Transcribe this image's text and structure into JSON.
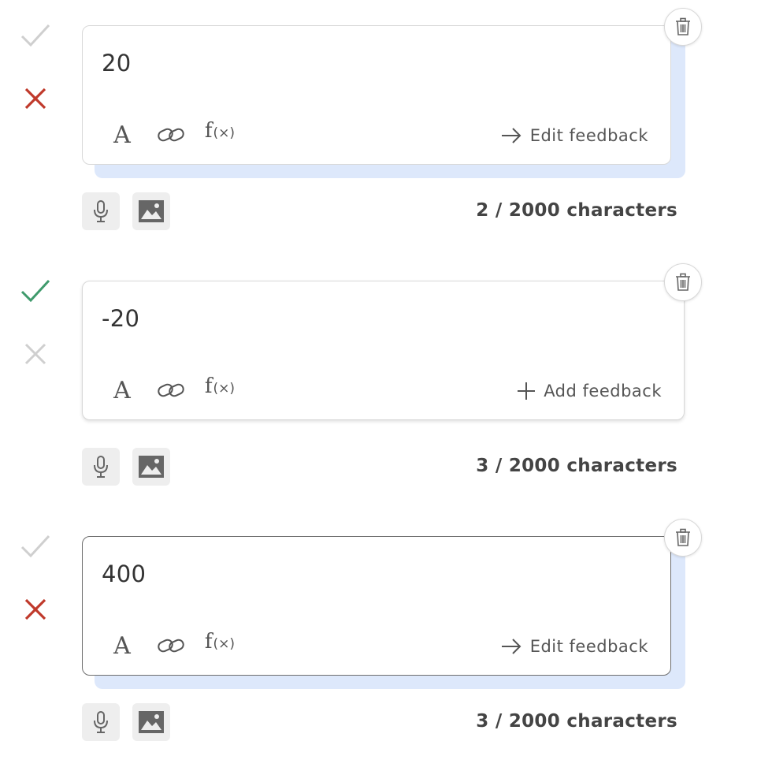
{
  "options": [
    {
      "answer": "20",
      "feedback_label": "Edit feedback",
      "feedback_icon": "arrow-right-icon",
      "char_count": "2 / 2000 characters",
      "is_correct": false,
      "check_color": "#cfcfcf",
      "cross_color": "#c0392b"
    },
    {
      "answer": "-20",
      "feedback_label": "Add feedback",
      "feedback_icon": "plus-icon",
      "char_count": "3 / 2000 characters",
      "is_correct": true,
      "check_color": "#3f9a6c",
      "cross_color": "#cfcfcf"
    },
    {
      "answer": "400",
      "feedback_label": "Edit feedback",
      "feedback_icon": "arrow-right-icon",
      "char_count": "3 / 2000 characters",
      "is_correct": false,
      "check_color": "#cfcfcf",
      "cross_color": "#c0392b"
    }
  ],
  "toolbar": {
    "font_glyph": "A",
    "fx_main": "f",
    "fx_small": "(×)"
  },
  "colors": {
    "accent_shadow": "#dde8fb",
    "correct": "#3f9a6c",
    "incorrect": "#c0392b",
    "inactive": "#cfcfcf"
  },
  "icons": {
    "check": "check-icon",
    "cross": "cross-icon",
    "trash": "trash-icon",
    "mic": "microphone-icon",
    "image": "image-icon",
    "font": "font-icon",
    "link": "link-icon",
    "formula": "formula-icon"
  }
}
